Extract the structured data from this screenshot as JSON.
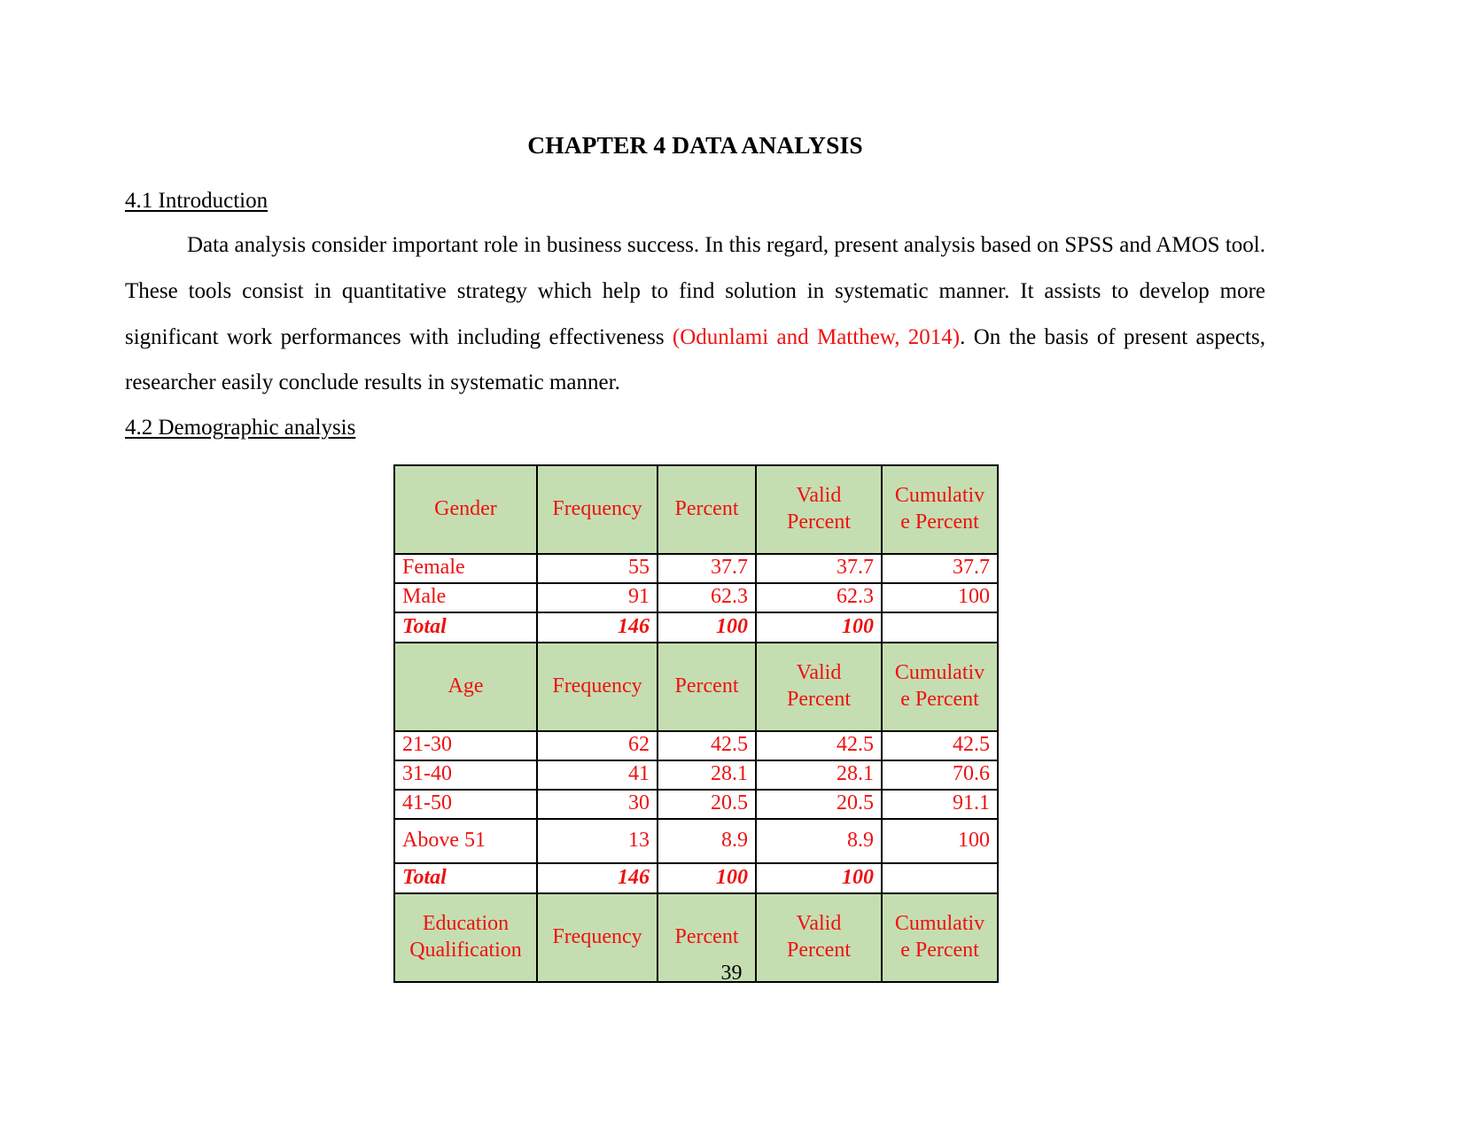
{
  "document": {
    "title": "CHAPTER 4 DATA ANALYSIS",
    "page_number": "39"
  },
  "sections": {
    "introduction": {
      "heading": "4.1 Introduction",
      "paragraph_part1": "Data analysis consider important role in business success. In this regard, present analysis based on SPSS and AMOS tool. These tools consist in quantitative strategy which help to find solution in systematic manner. It assists to develop more significant work performances with including effectiveness ",
      "citation": "(Odunlami and Matthew, 2014)",
      "paragraph_part2": ". On the basis of present aspects, researcher easily conclude results in systematic manner."
    },
    "demographic": {
      "heading": "4.2 Demographic analysis"
    }
  },
  "colors": {
    "header_fill": "#c5deb1",
    "table_text": "#ee1111",
    "citation_text": "#ee1111",
    "border": "#000000"
  },
  "table": {
    "columns": {
      "frequency": "Frequency",
      "percent": "Percent",
      "valid_percent": "Valid Percent",
      "cumulative_percent": "Cumulativ e Percent"
    },
    "blocks": [
      {
        "id": "gender",
        "label_header": "Gender",
        "rows": [
          {
            "label": "Female",
            "frequency": "55",
            "percent": "37.7",
            "valid_percent": "37.7",
            "cumulative_percent": "37.7"
          },
          {
            "label": "Male",
            "frequency": "91",
            "percent": "62.3",
            "valid_percent": "62.3",
            "cumulative_percent": "100"
          }
        ],
        "total": {
          "label": "Total",
          "frequency": "146",
          "percent": "100",
          "valid_percent": "100",
          "cumulative_percent": ""
        }
      },
      {
        "id": "age",
        "label_header": "Age",
        "rows": [
          {
            "label": "21-30",
            "frequency": "62",
            "percent": "42.5",
            "valid_percent": "42.5",
            "cumulative_percent": "42.5"
          },
          {
            "label": "31-40",
            "frequency": "41",
            "percent": "28.1",
            "valid_percent": "28.1",
            "cumulative_percent": "70.6"
          },
          {
            "label": "41-50",
            "frequency": "30",
            "percent": "20.5",
            "valid_percent": "20.5",
            "cumulative_percent": "91.1"
          },
          {
            "label": "Above 51",
            "frequency": "13",
            "percent": "8.9",
            "valid_percent": "8.9",
            "cumulative_percent": "100"
          }
        ],
        "total": {
          "label": "Total",
          "frequency": "146",
          "percent": "100",
          "valid_percent": "100",
          "cumulative_percent": ""
        }
      },
      {
        "id": "education",
        "label_header": "Education Qualification",
        "rows": [],
        "total": null
      }
    ]
  }
}
